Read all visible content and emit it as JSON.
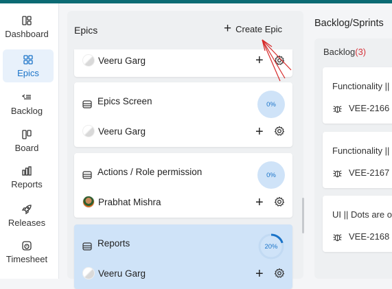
{
  "sidebar": {
    "items": [
      {
        "label": "Dashboard",
        "icon": "dashboard-icon",
        "active": false
      },
      {
        "label": "Epics",
        "icon": "epics-icon",
        "active": true
      },
      {
        "label": "Backlog",
        "icon": "backlog-icon",
        "active": false
      },
      {
        "label": "Board",
        "icon": "board-icon",
        "active": false
      },
      {
        "label": "Reports",
        "icon": "reports-icon",
        "active": false
      },
      {
        "label": "Releases",
        "icon": "rocket-icon",
        "active": false
      },
      {
        "label": "Timesheet",
        "icon": "timesheet-icon",
        "active": false
      }
    ]
  },
  "epics": {
    "title": "Epics",
    "create_label": "Create Epic",
    "cards": [
      {
        "title": "",
        "assignee": "Veeru Garg",
        "progress": ""
      },
      {
        "title": "Epics Screen",
        "assignee": "Veeru Garg",
        "progress": "0%"
      },
      {
        "title": "Actions / Role permission",
        "assignee": "Prabhat Mishra",
        "progress": "0%"
      },
      {
        "title": "Reports",
        "assignee": "Veeru Garg",
        "progress": "20%",
        "progress_fraction": 0.2,
        "selected": true
      }
    ]
  },
  "backlog": {
    "header": "Backlog/Sprints",
    "label": "Backlog",
    "count": "(3)",
    "items": [
      {
        "title": "Functionality ||",
        "key": "VEE-2166"
      },
      {
        "title": "Functionality ||",
        "key": "VEE-2167"
      },
      {
        "title": "UI || Dots are ov",
        "key": "VEE-2168"
      }
    ]
  },
  "colors": {
    "accent": "#1a73c8",
    "topbar": "#0b6a73",
    "selected_card": "#cfe3f8",
    "count": "#d6333a",
    "annotation_arrow": "#d62828"
  }
}
